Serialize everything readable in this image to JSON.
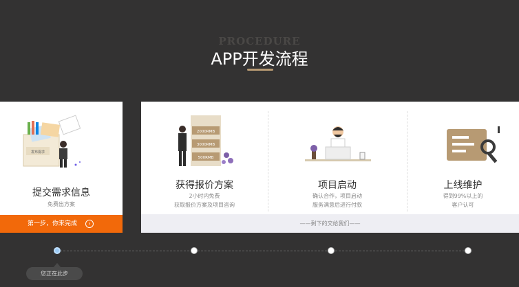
{
  "header": {
    "eyebrow": "PROCEDURE",
    "title": "APP开发流程"
  },
  "steps": [
    {
      "title": "提交需求信息",
      "desc": [
        "免费出方案"
      ],
      "illustration_label": "发布需求",
      "cta": "第一步，你来完成"
    },
    {
      "title": "获得报价方案",
      "desc": [
        "2小时内免费",
        "获取报价方案及项目咨询"
      ],
      "price_tags": [
        "2000RMB",
        "3000RMB",
        "500RMB"
      ]
    },
    {
      "title": "项目启动",
      "desc": [
        "确认合作，项目启动",
        "服务满意后进行付款"
      ]
    },
    {
      "title": "上线维护",
      "desc": [
        "得到99%以上的",
        "客户认可"
      ]
    }
  ],
  "footer_note": "——剩下的交给我们——",
  "timeline": {
    "tooltip": "您正在此步",
    "active_index": 0
  },
  "colors": {
    "background": "#333232",
    "accent_orange": "#f2690a",
    "gold": "#b79a73"
  }
}
